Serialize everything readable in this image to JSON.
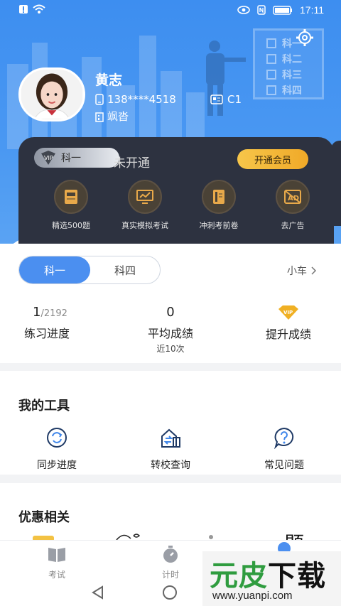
{
  "status_bar": {
    "time": "17:11",
    "battery_icon": "battery-icon",
    "wifi_icon": "wifi-icon"
  },
  "profile": {
    "name": "黄志",
    "phone": "138****4518",
    "license": "C1",
    "city": "飒沓"
  },
  "checklist": {
    "items": [
      "科一",
      "科二",
      "科三",
      "科四"
    ]
  },
  "vip": {
    "badge_label": "科一",
    "status": "未开通",
    "open_button": "开通会员",
    "features": [
      {
        "label": "精选500题",
        "icon": "book-500-icon"
      },
      {
        "label": "真实模拟考试",
        "icon": "monitor-chart-icon"
      },
      {
        "label": "冲刺考前卷",
        "icon": "paper-icon"
      },
      {
        "label": "去广告",
        "icon": "no-ad-icon"
      }
    ]
  },
  "subjects": {
    "active": "科一",
    "inactive": "科四",
    "car_type": "小车"
  },
  "stats": {
    "progress_value": "1",
    "progress_total": "/2192",
    "progress_label": "练习进度",
    "avg_value": "0",
    "avg_label": "平均成绩",
    "avg_sub": "近10次",
    "improve_label": "提升成绩"
  },
  "tools": {
    "title": "我的工具",
    "items": [
      {
        "label": "同步进度",
        "icon": "sync-icon"
      },
      {
        "label": "转校查询",
        "icon": "school-transfer-icon"
      },
      {
        "label": "常见问题",
        "icon": "question-icon"
      }
    ]
  },
  "promo": {
    "title": "优惠相关",
    "peek_text": "题"
  },
  "tabbar": {
    "tabs": [
      {
        "label": "考试",
        "icon": "book-open-icon"
      },
      {
        "label": "计时",
        "icon": "stopwatch-icon"
      }
    ]
  },
  "watermark": {
    "brand_green": "元皮",
    "brand_black": "下载",
    "url": "www.yuanpi.com"
  },
  "colors": {
    "primary": "#4b8ff0",
    "vip_card": "#2d3240",
    "vip_gold": "#f0a928"
  }
}
